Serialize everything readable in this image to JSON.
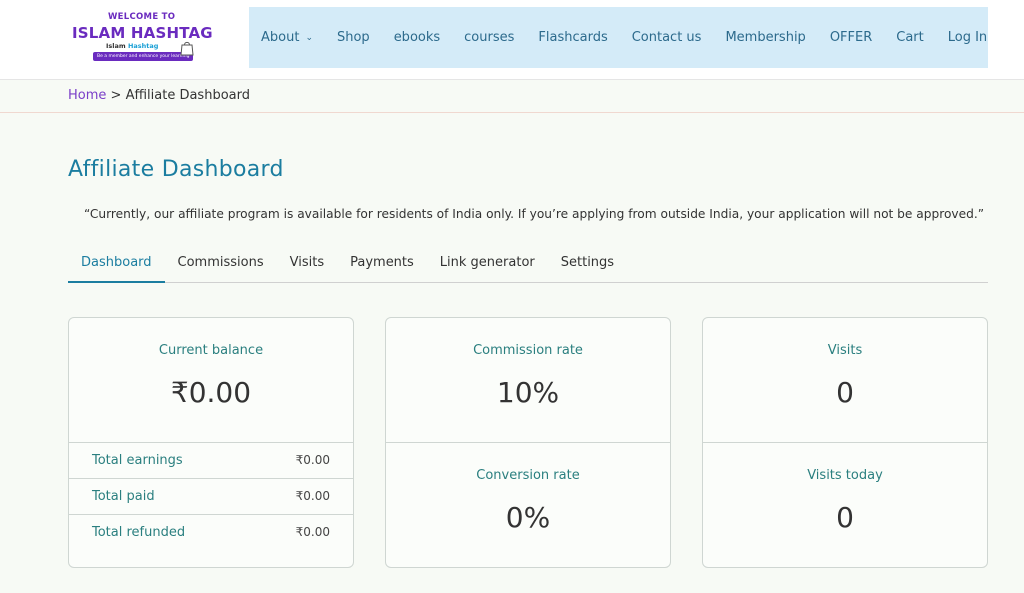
{
  "logo": {
    "welcome": "WELCOME TO",
    "title": "ISLAM HASHTAG",
    "sub_a": "Islam",
    "sub_b": "Hashtag",
    "tagline": "Be a member and enhance your learning",
    "brand_color": "#6a2bbf"
  },
  "nav": {
    "items": [
      {
        "label": "About",
        "has_dropdown": true
      },
      {
        "label": "Shop"
      },
      {
        "label": "ebooks"
      },
      {
        "label": "courses"
      },
      {
        "label": "Flashcards"
      },
      {
        "label": "Contact us"
      },
      {
        "label": "Membership"
      },
      {
        "label": "OFFER"
      },
      {
        "label": "Cart"
      },
      {
        "label": "Log In"
      }
    ],
    "background": "#d4ebf8"
  },
  "breadcrumb": {
    "home": "Home",
    "separator": ">",
    "current": "Affiliate Dashboard"
  },
  "page": {
    "title": "Affiliate Dashboard",
    "notice": "“Currently, our affiliate program is available for residents of India only. If you’re applying from outside India, your application will not be approved.”"
  },
  "tabs": [
    {
      "label": "Dashboard",
      "active": true
    },
    {
      "label": "Commissions"
    },
    {
      "label": "Visits"
    },
    {
      "label": "Payments"
    },
    {
      "label": "Link generator"
    },
    {
      "label": "Settings"
    }
  ],
  "balance_card": {
    "label": "Current balance",
    "value": "₹0.00",
    "rows": [
      {
        "label": "Total earnings",
        "value": "₹0.00"
      },
      {
        "label": "Total paid",
        "value": "₹0.00"
      },
      {
        "label": "Total refunded",
        "value": "₹0.00"
      }
    ]
  },
  "rate_card": {
    "commission_label": "Commission rate",
    "commission_value": "10%",
    "conversion_label": "Conversion rate",
    "conversion_value": "0%"
  },
  "visits_card": {
    "visits_label": "Visits",
    "visits_value": "0",
    "today_label": "Visits today",
    "today_value": "0"
  },
  "colors": {
    "accent": "#1b7da0",
    "label_teal": "#2a7f7f",
    "link_purple": "#7a3fc8"
  }
}
